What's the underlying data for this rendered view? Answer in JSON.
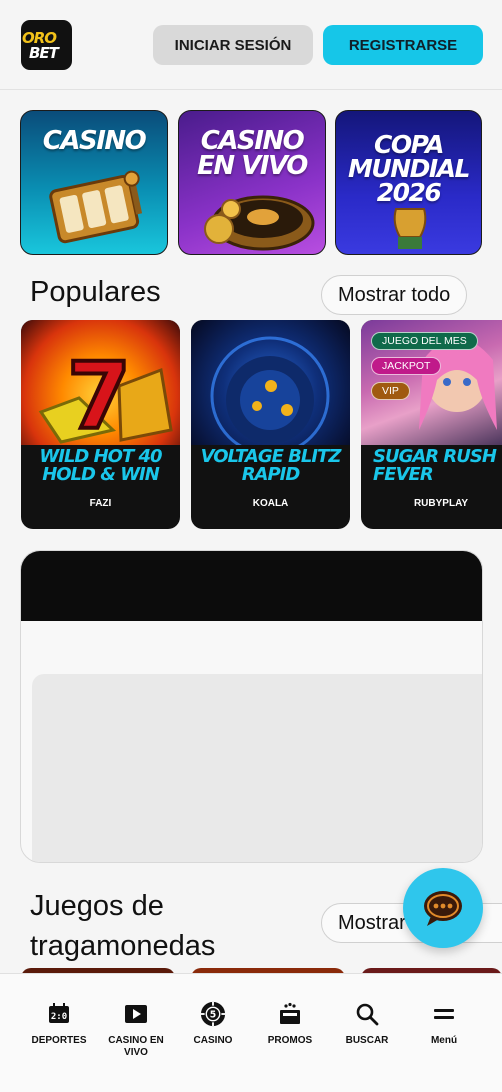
{
  "header": {
    "logo_line1": "ORO",
    "logo_line2": "BET",
    "login_label": "INICIAR SESIÓN",
    "register_label": "REGISTRARSE"
  },
  "categories": [
    {
      "label": "CASINO"
    },
    {
      "label": "CASINO EN VIVO"
    },
    {
      "label": "COPA MUNDIAL 2026"
    }
  ],
  "popular": {
    "title": "Populares",
    "show_all": "Mostrar todo",
    "games": [
      {
        "name": "WILD HOT 40 HOLD & WIN",
        "provider": "FAZI"
      },
      {
        "name": "VOLTAGE BLITZ RAPID",
        "provider": "KOALA"
      },
      {
        "name": "SUGAR RUSH FEVER",
        "provider": "RUBYPLAY",
        "badges": [
          "JUEGO DEL MES",
          "JACKPOT",
          "VIP"
        ]
      }
    ]
  },
  "slots": {
    "title": "Juegos de tragamonedas",
    "show_all": "Mostrar todo"
  },
  "nav": [
    {
      "label": "DEPORTES",
      "icon": "scoreboard-icon"
    },
    {
      "label": "CASINO EN VIVO",
      "icon": "play-icon"
    },
    {
      "label": "CASINO",
      "icon": "chip-icon"
    },
    {
      "label": "PROMOS",
      "icon": "gift-icon"
    },
    {
      "label": "BUSCAR",
      "icon": "search-icon"
    },
    {
      "label": "Menú",
      "icon": "menu-icon"
    }
  ],
  "colors": {
    "accent": "#16c6e8",
    "text": "#111111",
    "background": "#f5f5f5"
  }
}
